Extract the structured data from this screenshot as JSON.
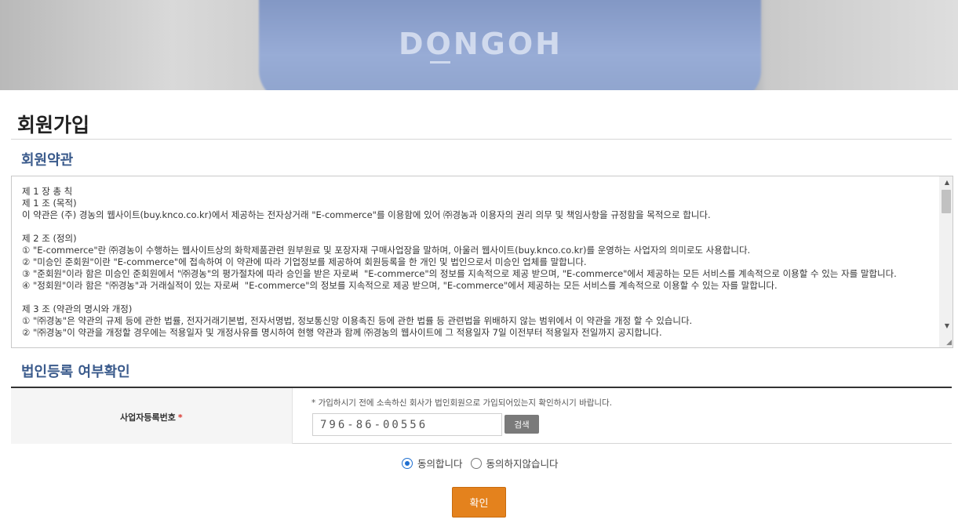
{
  "hero": {
    "logo_text": "DONGOH"
  },
  "page": {
    "title": "회원가입"
  },
  "terms": {
    "section_title": "회원약관",
    "text": "제 1 장 총 칙\n제 1 조 (목적)\n이 약관은 (주) 경농의 웹사이트(buy.knco.co.kr)에서 제공하는 전자상거래 \"E-commerce\"를 이용함에 있어 ㈜경농과 이용자의 권리 의무 및 책임사항을 규정함을 목적으로 합니다.\n\n제 2 조 (정의)\n① \"E-commerce\"란 ㈜경농이 수행하는 웹사이트상의 화학제품관련 원부원료 및 포장자재 구매사업장을 말하며, 아울러 웹사이트(buy.knco.co.kr)를 운영하는 사업자의 의미로도 사용합니다.\n② \"미승인 준회원\"이란 \"E-commerce\"에 접속하여 이 약관에 따라 기업정보를 제공하여 회원등록을 한 개인 및 법인으로서 미승인 업체를 말합니다.\n③ \"준회원\"이라 함은 미승인 준회원에서 \"㈜경농\"의 평가절차에 따라 승인을 받은 자로써  \"E-commerce\"의 정보를 지속적으로 제공 받으며, \"E-commerce\"에서 제공하는 모든 서비스를 계속적으로 이용할 수 있는 자를 말합니다.\n④ \"정회원\"이라 함은 \"㈜경농\"과 거래실적이 있는 자로써  \"E-commerce\"의 정보를 지속적으로 제공 받으며, \"E-commerce\"에서 제공하는 모든 서비스를 계속적으로 이용할 수 있는 자를 말합니다.\n\n제 3 조 (약관의 명시와 개정)\n① \"㈜경농\"은 약관의 규제 등에 관한 법률, 전자거래기본법, 전자서명법, 정보통신망 이용촉진 등에 관한 법률 등 관련법을 위배하지 않는 범위에서 이 약관을 개정 할 수 있습니다.\n② \"㈜경농\"이 약관을 개정할 경우에는 적용일자 및 개정사유를 명시하여 현행 약관과 함께 ㈜경농의 웹사이트에 그 적용일자 7일 이전부터 적용일자 전일까지 공지합니다."
  },
  "business": {
    "section_title": "법인등록 여부확인",
    "label": "사업자등록번호",
    "required_mark": "*",
    "note": "* 가입하시기 전에 소속하신 회사가 법인회원으로 가입되어있는지 확인하시기 바랍니다.",
    "reg_number_value": "796-86-00556",
    "search_label": "검색"
  },
  "agreement": {
    "agree_label": "동의합니다",
    "disagree_label": "동의하지않습니다",
    "selected": "agree"
  },
  "confirm_label": "확인",
  "colors": {
    "section_title": "#3b5b8c",
    "confirm_button": "#e4821d",
    "search_button": "#7a7a7a",
    "required": "#d8342d"
  }
}
